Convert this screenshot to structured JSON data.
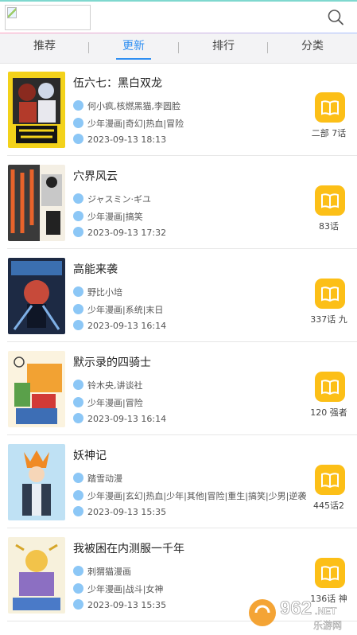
{
  "header": {
    "logo": "broken-image",
    "search_icon": "search-icon"
  },
  "tabs": [
    {
      "label": "推荐",
      "active": false
    },
    {
      "label": "更新",
      "active": true
    },
    {
      "label": "排行",
      "active": false
    },
    {
      "label": "分类",
      "active": false
    }
  ],
  "items": [
    {
      "title": "伍六七：黑白双龙",
      "author": "何小疯,核燃黑猫,李圆脸",
      "tags": "少年漫画|奇幻|热血|冒险",
      "time": "2023-09-13 18:13",
      "chapter": "二部 7话"
    },
    {
      "title": "穴界风云",
      "author": "ジャスミン·ギユ",
      "tags": "少年漫画|搞笑",
      "time": "2023-09-13 17:32",
      "chapter": "83话"
    },
    {
      "title": "高能来袭",
      "author": "野比小培",
      "tags": "少年漫画|系统|末日",
      "time": "2023-09-13 16:14",
      "chapter": "337话 九"
    },
    {
      "title": "默示录的四骑士",
      "author": "铃木央,讲谈社",
      "tags": "少年漫画|冒险",
      "time": "2023-09-13 16:14",
      "chapter": "120 强者"
    },
    {
      "title": "妖神记",
      "author": "踏雪动漫",
      "tags": "少年漫画|玄幻|热血|少年|其他|冒险|重生|搞笑|少男|逆袭",
      "time": "2023-09-13 15:35",
      "chapter": "445话2"
    },
    {
      "title": "我被困在内测服一千年",
      "author": "刺猬猫漫画",
      "tags": "少年漫画|战斗|女神",
      "time": "2023-09-13 15:35",
      "chapter": "136话 神"
    }
  ],
  "watermark": {
    "number": "962",
    "suffix": ".NET",
    "name": "乐游网"
  },
  "colors": {
    "accent_blue": "#2f8ff2",
    "book_yellow": "#fcbf17",
    "meta_icon": "#8cc7f6"
  }
}
